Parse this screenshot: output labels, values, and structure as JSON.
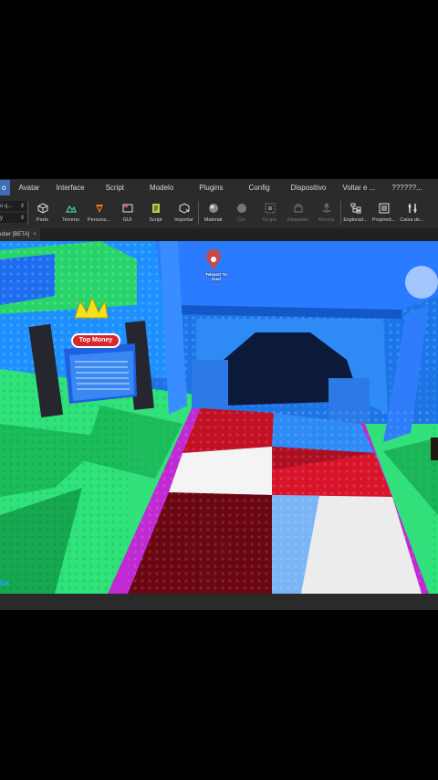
{
  "menu": {
    "items": [
      "o",
      "Avatar",
      "Interface",
      "Script",
      "Modelo",
      "Plugins",
      "Config",
      "Dispositivo",
      "Voltar e ...",
      "??????..."
    ]
  },
  "toolbar": {
    "left_fields": [
      "o q...",
      "y"
    ],
    "tools": [
      {
        "label": "Parte",
        "icon": "part-cube-icon"
      },
      {
        "label": "Terreno",
        "icon": "terrain-icon"
      },
      {
        "label": "Persona...",
        "icon": "character-icon"
      },
      {
        "label": "GUI",
        "icon": "gui-icon"
      },
      {
        "label": "Script",
        "icon": "script-icon"
      },
      {
        "label": "Importar",
        "icon": "import-icon"
      },
      {
        "label": "Material",
        "icon": "material-icon"
      },
      {
        "label": "Cor",
        "icon": "color-icon"
      },
      {
        "label": "Grupo",
        "icon": "group-icon"
      },
      {
        "label": "Etiquetas",
        "icon": "tags-icon"
      },
      {
        "label": "Âncora",
        "icon": "anchor-icon"
      },
      {
        "label": "Explorad...",
        "icon": "explorer-icon"
      },
      {
        "label": "Propried...",
        "icon": "properties-icon"
      },
      {
        "label": "Caixa de...",
        "icon": "toolbox-icon"
      }
    ]
  },
  "tab": {
    "label": "uber [BETA]",
    "close": "×"
  },
  "viewport": {
    "sign_title": "Top Money",
    "teleport_label": "Teleport To Duel",
    "corner_text": "bx"
  },
  "colors": {
    "menubar_bg": "#2b2b2b",
    "active_tab": "#3d6fb6",
    "sky": "#1e9aff",
    "grass": "#27d46a",
    "checker_red": "#e0142a",
    "checker_white": "#f4f4f4",
    "border_purple": "#c02ad2"
  }
}
